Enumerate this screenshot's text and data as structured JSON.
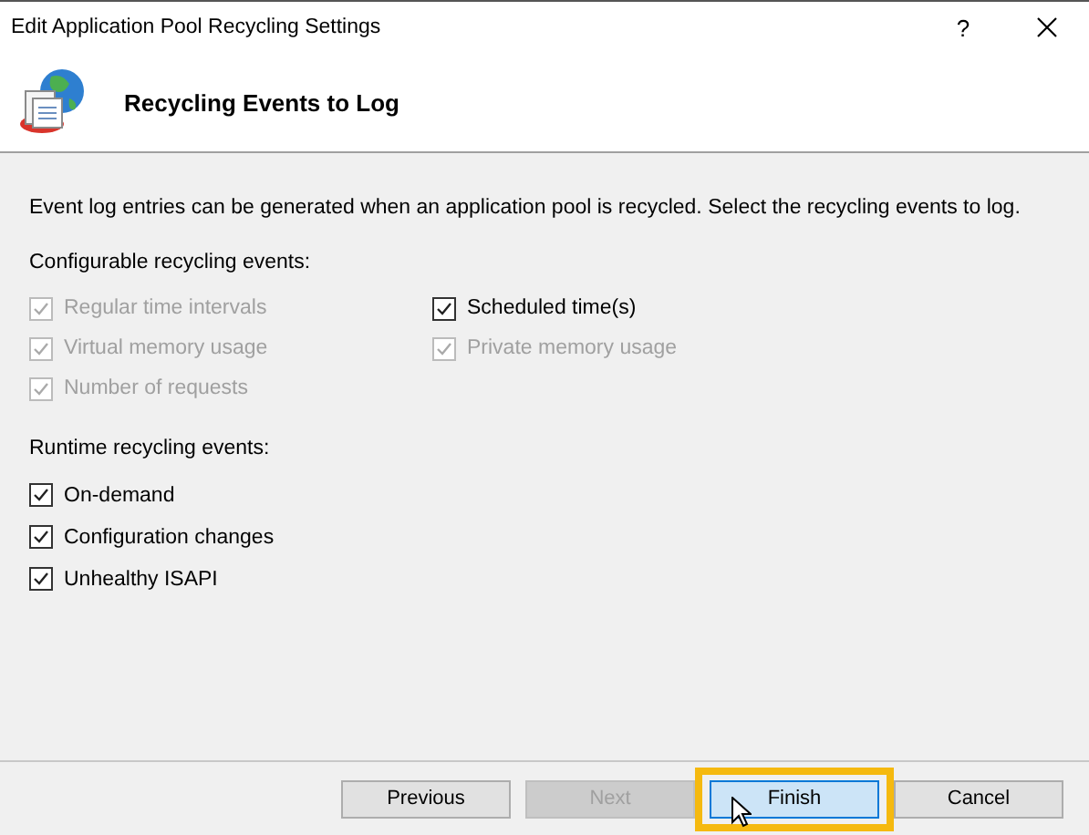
{
  "window": {
    "title": "Edit Application Pool Recycling Settings",
    "help": "?"
  },
  "header": {
    "title": "Recycling Events to Log"
  },
  "description": "Event log entries can be generated when an application pool is recycled. Select the recycling events to log.",
  "configurable": {
    "label": "Configurable recycling events:",
    "items": [
      {
        "label": "Regular time intervals",
        "checked": true,
        "disabled": true
      },
      {
        "label": "Virtual memory usage",
        "checked": true,
        "disabled": true
      },
      {
        "label": "Number of requests",
        "checked": true,
        "disabled": true
      },
      {
        "label": "Scheduled time(s)",
        "checked": true,
        "disabled": false
      },
      {
        "label": "Private memory usage",
        "checked": true,
        "disabled": true
      }
    ]
  },
  "runtime": {
    "label": "Runtime recycling events:",
    "items": [
      {
        "label": "On-demand",
        "checked": true,
        "disabled": false
      },
      {
        "label": "Configuration changes",
        "checked": true,
        "disabled": false
      },
      {
        "label": "Unhealthy ISAPI",
        "checked": true,
        "disabled": false
      }
    ]
  },
  "buttons": [
    {
      "label": "Previous",
      "disabled": false,
      "highlighted": false
    },
    {
      "label": "Next",
      "disabled": true,
      "highlighted": false
    },
    {
      "label": "Finish",
      "disabled": false,
      "highlighted": true
    },
    {
      "label": "Cancel",
      "disabled": false,
      "highlighted": false
    }
  ]
}
